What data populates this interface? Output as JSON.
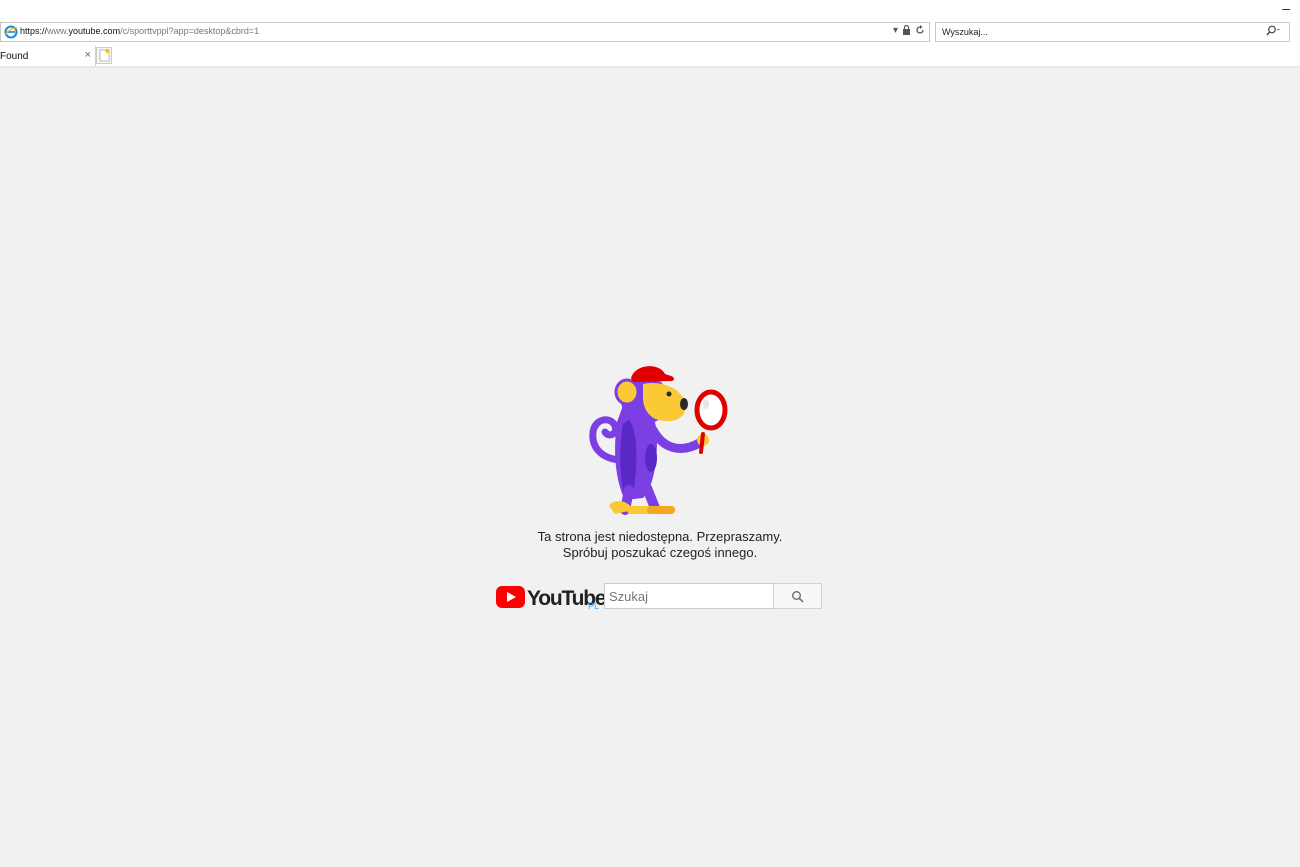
{
  "browser": {
    "minimize_label": "–",
    "url_scheme": "https://",
    "url_www": "www.",
    "url_host": "youtube.com",
    "url_path": "/c/sporttvppl?app=desktop&cbrd=1",
    "search_placeholder": "Wyszukaj...",
    "tab_title": "Found",
    "tab_close": "×"
  },
  "page": {
    "message_line1": "Ta strona jest niedostępna. Przepraszamy.",
    "message_line2": "Spróbuj poszukać czegoś innego.",
    "logo_text": "YouTube",
    "logo_region": "PL",
    "search_placeholder": "Szukaj"
  },
  "colors": {
    "yt_red": "#ff0000",
    "monkey_purple": "#7b3fe4",
    "monkey_yellow": "#fbc936",
    "background": "#f1f1f1"
  },
  "icons": {
    "browser": "ie-icon",
    "lock": "lock-icon",
    "refresh": "refresh-icon",
    "search": "search-icon"
  }
}
